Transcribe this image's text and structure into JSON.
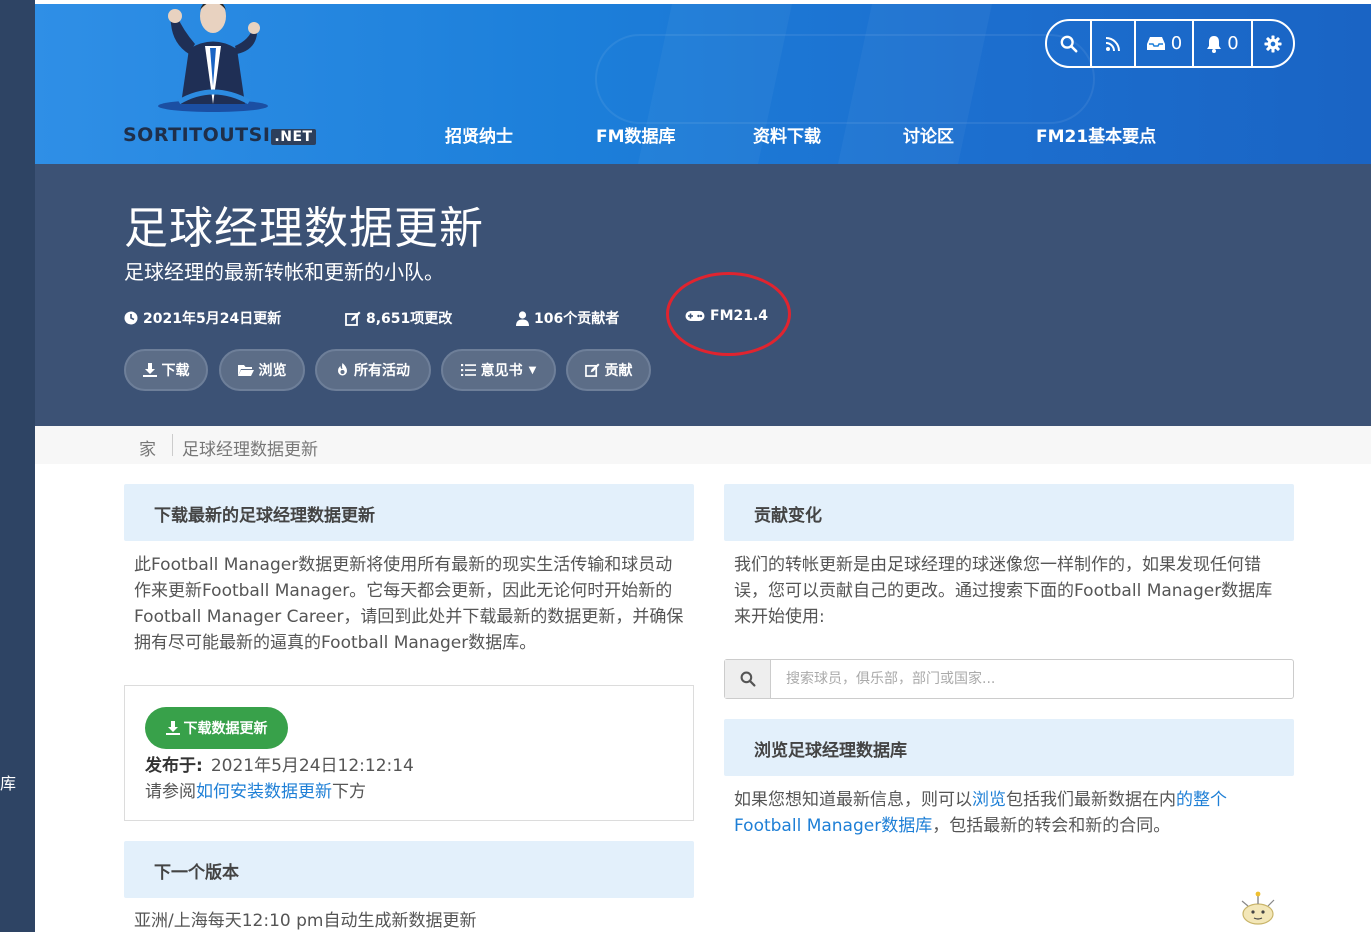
{
  "side": {
    "char": "库"
  },
  "brand": {
    "wordmark": "SORTITOUTSI",
    "wordmark_suffix": ".NET"
  },
  "nav": [
    {
      "label": "招贤纳士"
    },
    {
      "label": "FM数据库"
    },
    {
      "label": "资料下载"
    },
    {
      "label": "讨论区"
    },
    {
      "label": "FM21基本要点"
    }
  ],
  "toolbar": {
    "inbox_count": "0",
    "notifications_count": "0"
  },
  "hero": {
    "title": "足球经理数据更新",
    "subtitle": "足球经理的最新转帐和更新的小队。",
    "meta": {
      "updated": "2021年5月24日更新",
      "changes": "8,651项更改",
      "contributors": "106个贡献者",
      "version": "FM21.4"
    },
    "actions": {
      "download": "下载",
      "browse": "浏览",
      "activity": "所有活动",
      "feedback": "意见书",
      "contribute": "贡献"
    }
  },
  "breadcrumb": {
    "home": "家",
    "current": "足球经理数据更新"
  },
  "left": {
    "download_heading": "下载最新的足球经理数据更新",
    "download_text": "此Football Manager数据更新将使用所有最新的现实生活传输和球员动作来更新Football Manager。它每天都会更新，因此无论何时开始新的Football Manager Career，请回到此处并下载最新的数据更新，并确保拥有尽可能最新的逼真的Football Manager数据库。",
    "download_button": "下载数据更新",
    "published_label": "发布于:",
    "published_value": "2021年5月24日12:12:14",
    "see_prefix": "请参阅",
    "see_link": "如何安装数据更新",
    "see_suffix": "下方",
    "next_heading": "下一个版本",
    "next_text": "亚洲/上海每天12:10 pm自动生成新数据更新"
  },
  "right": {
    "contribute_heading": "贡献变化",
    "contribute_text": "我们的转帐更新是由足球经理的球迷像您一样制作的，如果发现任何错误，您可以贡献自己的更改。通过搜索下面的Football Manager数据库来开始使用:",
    "search_placeholder": "搜索球员，俱乐部，部门或国家...",
    "browse_heading": "浏览足球经理数据库",
    "browse_prefix": "如果您想知道最新信息，则可以",
    "browse_link1": "浏览",
    "browse_mid": "包括我们最新数据在内",
    "browse_link2": "的整个Football Manager数据库",
    "browse_suffix": "，包括最新的转会和新的合同。"
  },
  "colors": {
    "header_blue": "#1c7fda",
    "hero_navy": "#3c5275",
    "panel_blue": "#e3f0fb",
    "link_blue": "#1e7fd6",
    "download_green": "#38a14a",
    "highlight_red": "#e0242f"
  }
}
